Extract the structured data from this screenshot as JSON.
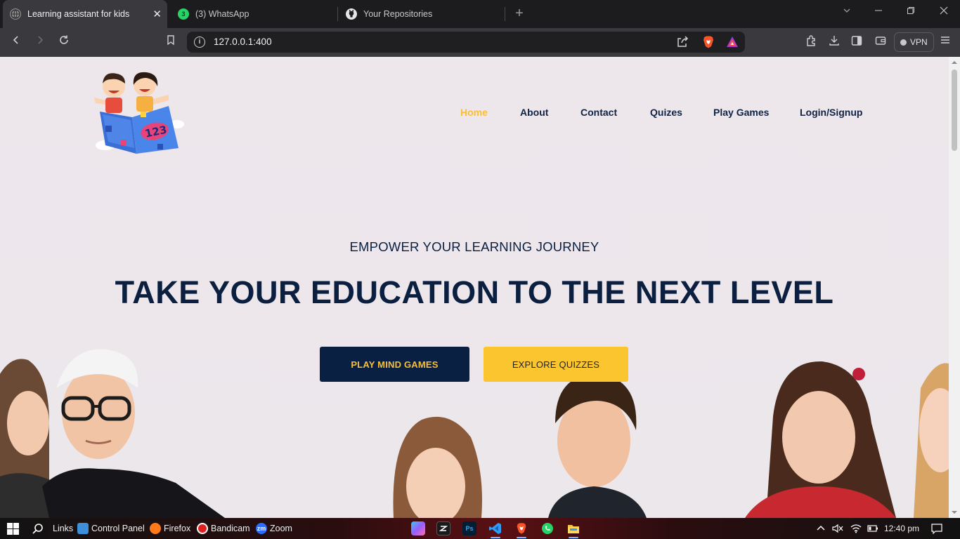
{
  "browser": {
    "tabs": [
      {
        "title": "Learning assistant for kids",
        "active": true,
        "icon": "globe-icon"
      },
      {
        "title": "(3) WhatsApp",
        "active": false,
        "icon": "whatsapp-icon",
        "badge": "3"
      },
      {
        "title": "Your Repositories",
        "active": false,
        "icon": "github-icon"
      }
    ],
    "close_tab_glyph": "✕",
    "new_tab_glyph": "+",
    "url": "127.0.0.1:400",
    "vpn_label": "VPN"
  },
  "site": {
    "nav": [
      {
        "label": "Home",
        "active": true
      },
      {
        "label": "About",
        "active": false
      },
      {
        "label": "Contact",
        "active": false
      },
      {
        "label": "Quizes",
        "active": false
      },
      {
        "label": "Play Games",
        "active": false
      },
      {
        "label": "Login/Signup",
        "active": false
      }
    ],
    "logo_text": "123",
    "hero": {
      "eyebrow": "EMPOWER YOUR LEARNING JOURNEY",
      "headline": "TAKE YOUR EDUCATION TO THE NEXT LEVEL",
      "primary_button": "PLAY MIND GAMES",
      "secondary_button": "EXPLORE QUIZZES"
    },
    "colors": {
      "navy": "#0a2042",
      "yellow": "#fbc52f",
      "nav_active": "#fbbf33",
      "background": "#ede6eb"
    }
  },
  "taskbar": {
    "items": [
      {
        "label": "Links"
      },
      {
        "label": "Control Panel"
      },
      {
        "label": "Firefox"
      },
      {
        "label": "Bandicam"
      },
      {
        "label": "Zoom",
        "icon_text": "zm"
      }
    ],
    "pinned": [
      "copilot-icon",
      "capcut-icon",
      "photoshop-icon",
      "vscode-icon",
      "brave-icon",
      "whatsapp-icon",
      "file-explorer-icon"
    ],
    "photoshop_text": "Ps",
    "clock": "12:40 pm"
  }
}
